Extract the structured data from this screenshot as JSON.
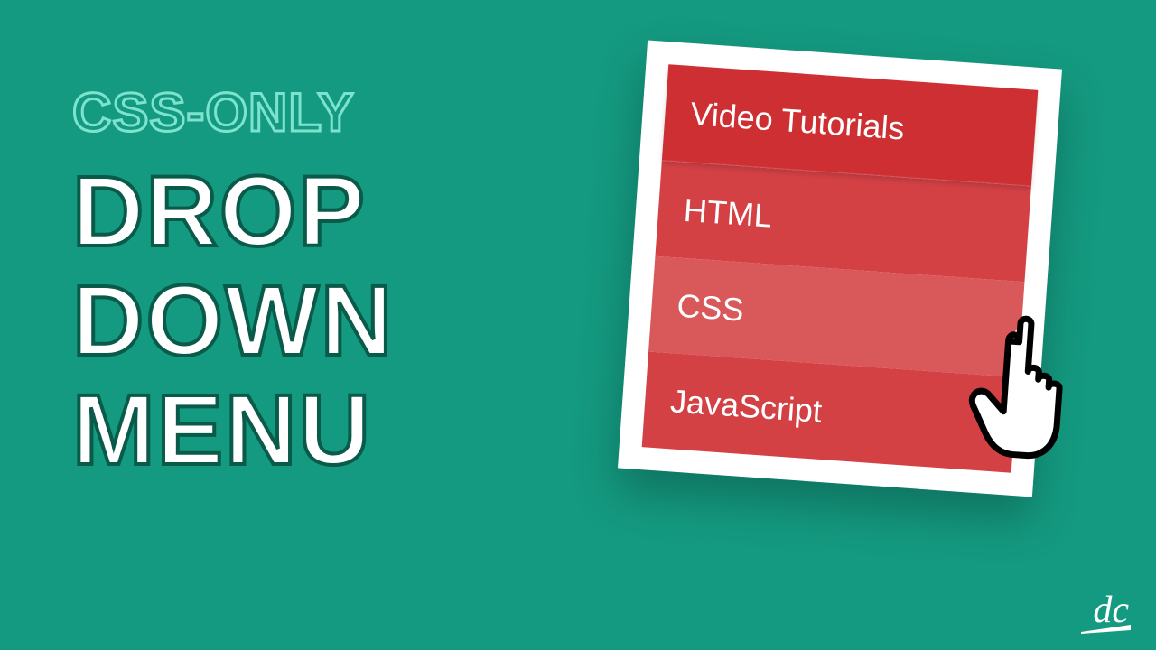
{
  "title": {
    "eyebrow": "CSS-ONLY",
    "line1": "DROP",
    "line2": "DOWN",
    "line3": "MENU"
  },
  "menu": {
    "header": "Video Tutorials",
    "items": [
      "HTML",
      "CSS",
      "JavaScript"
    ],
    "hovered_index": 1
  },
  "logo": {
    "text": "dc"
  },
  "colors": {
    "background": "#149a80",
    "menu_base": "#cd2f33",
    "menu_option": "#d34145",
    "menu_hover": "#d9585a",
    "accent": "#7de3cf"
  }
}
